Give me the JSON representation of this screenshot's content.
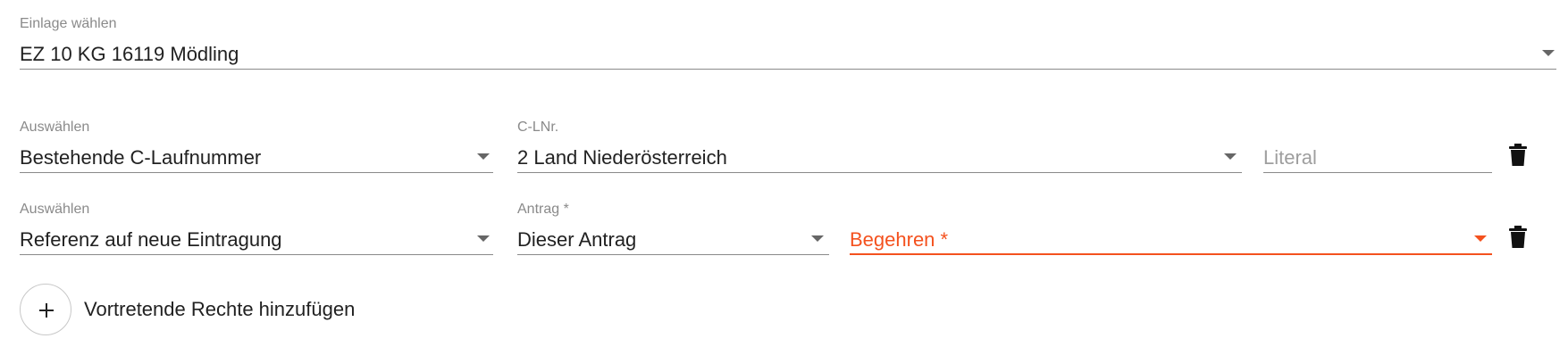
{
  "einlage": {
    "label": "Einlage wählen",
    "value": "EZ 10 KG 16119 Mödling"
  },
  "row1": {
    "auswahl": {
      "label": "Auswählen",
      "value": "Bestehende C-Laufnummer"
    },
    "clnr": {
      "label": "C-LNr.",
      "value": "2 Land Niederösterreich"
    },
    "literal": {
      "placeholder": "Literal"
    }
  },
  "row2": {
    "auswahl": {
      "label": "Auswählen",
      "value": "Referenz auf neue Eintragung"
    },
    "antrag": {
      "label": "Antrag *",
      "value": "Dieser Antrag"
    },
    "begehren": {
      "placeholder": "Begehren *"
    }
  },
  "add_button": {
    "label": "Vortretende Rechte hinzufügen"
  },
  "icons": {
    "dropdown": "chevron-down-icon",
    "delete": "trash-icon",
    "add": "plus-icon"
  },
  "colors": {
    "error": "#f4511e",
    "underline": "#8a8a8a",
    "text": "#212121"
  }
}
